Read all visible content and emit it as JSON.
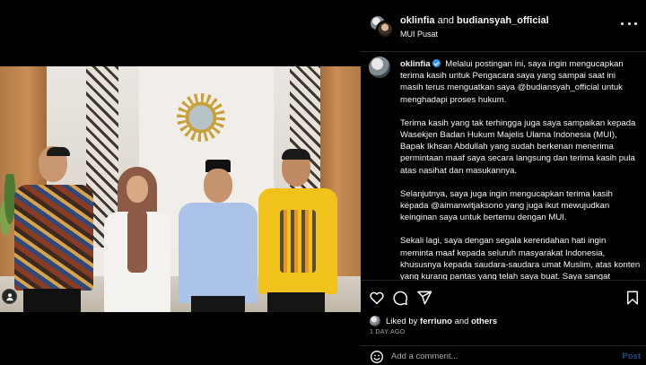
{
  "header": {
    "username_1": "oklinfia",
    "and_text": "and",
    "username_2": "budiansyah_official",
    "location": "MUI Pusat"
  },
  "caption": {
    "username": "oklinfia",
    "paragraphs": [
      "Melalui postingan ini, saya ingin mengucapkan terima kasih untuk Pengacara saya yang sampai saat ini masih terus menguatkan saya @budiansyah_official untuk menghadapi proses hukum.",
      "Terima kasih yang tak terhingga juga saya sampaikan kepada Wasekjen Badan Hukum Majelis Ulama Indonesia (MUI), Bapak Ikhsan Abdullah yang sudah berkenan menerima permintaan maaf saya secara langsung dan terima kasih pula atas nasihat dan masukannya.",
      "Selanjutnya, saya juga ingin mengucapkan terima kasih kepada @aimanwitjaksono yang juga ikut mewujudkan keinginan saya untuk bertemu dengan MUI.",
      "Sekali lagi, saya dengan segala kerendahan hati ingin meminta maaf kepada seluruh masyarakat Indonesia, khususnya kepada saudara-saudara umat Muslim, atas konten yang kurang pantas yang telah saya buat. Saya sangat menyesal atas ketidakbijaksanaan tersebut dan saya berjanji untuk tidak mengulanginya kembali."
    ]
  },
  "likes": {
    "prefix": "Liked by",
    "user": "ferriuno",
    "and_text": "and",
    "others": "others"
  },
  "time_ago": "1 DAY AGO",
  "comment": {
    "placeholder": "Add a comment...",
    "post_label": "Post"
  },
  "icons": {
    "heart": "heart-icon",
    "comment": "comment-icon",
    "share": "share-icon",
    "save": "bookmark-icon",
    "emoji": "emoji-icon",
    "more": "more-options-icon",
    "tagged_user": "user-tag-icon"
  },
  "colors": {
    "background": "#000000",
    "text": "#f5f5f5",
    "muted": "#a8a8a8",
    "verified": "#3897f0",
    "post_button": "#1f4f7e"
  }
}
